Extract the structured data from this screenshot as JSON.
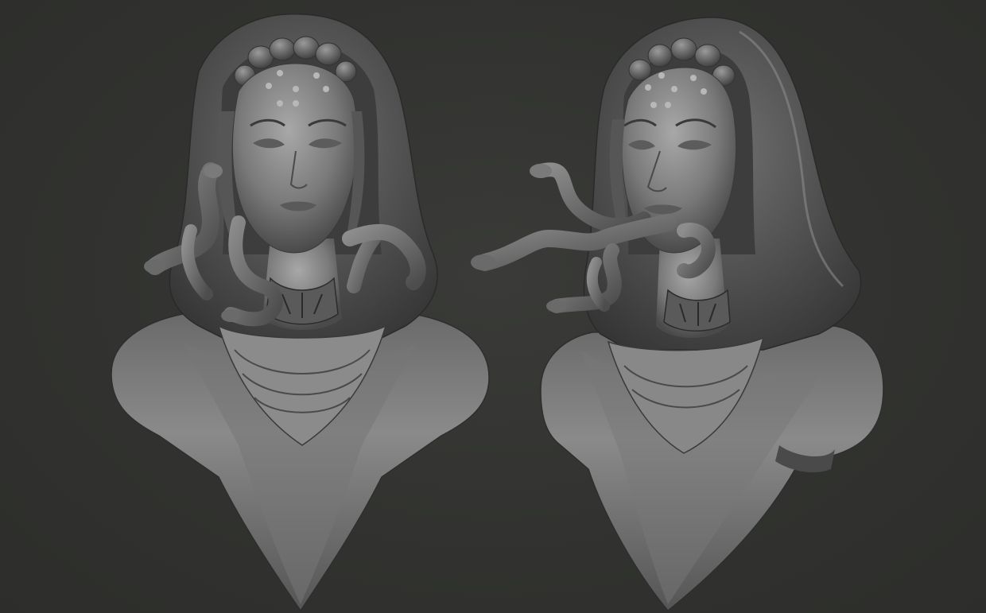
{
  "scene": {
    "background_color": "#31322f",
    "material_color": "#6e6e6e",
    "views": [
      {
        "subject": "hooded-gorgon-bust",
        "angle": "front"
      },
      {
        "subject": "hooded-gorgon-bust",
        "angle": "three-quarter"
      }
    ]
  }
}
